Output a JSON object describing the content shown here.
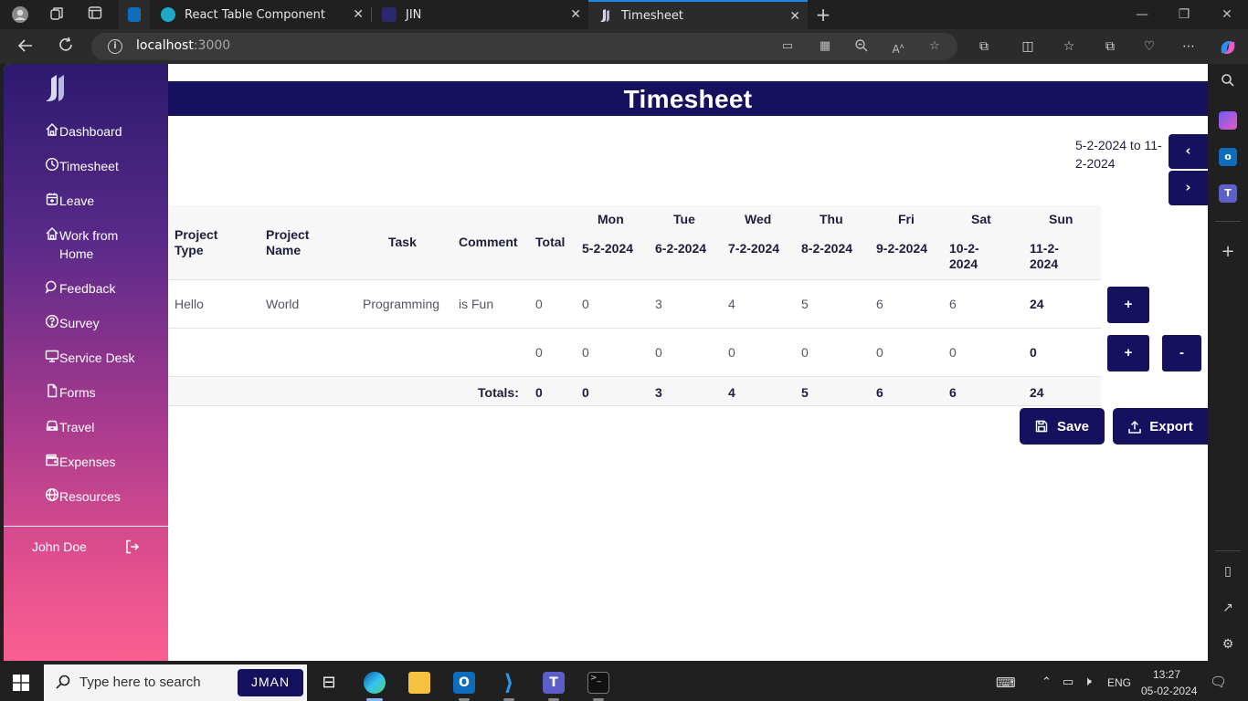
{
  "browser": {
    "tabs": [
      {
        "title": "React Table Component",
        "active": false
      },
      {
        "title": "JIN",
        "active": false
      },
      {
        "title": "Timesheet",
        "active": true
      }
    ],
    "url_host": "localhost",
    "url_port": ":3000"
  },
  "sidebar": {
    "items": [
      {
        "label": "Dashboard",
        "icon": "home-icon"
      },
      {
        "label": "Timesheet",
        "icon": "clock-icon"
      },
      {
        "label": "Leave",
        "icon": "calendar-icon"
      },
      {
        "label": "Work from Home",
        "icon": "home-icon"
      },
      {
        "label": "Feedback",
        "icon": "chat-icon"
      },
      {
        "label": "Survey",
        "icon": "question-circle-icon"
      },
      {
        "label": "Service Desk",
        "icon": "monitor-icon"
      },
      {
        "label": "Forms",
        "icon": "document-icon"
      },
      {
        "label": "Travel",
        "icon": "car-icon"
      },
      {
        "label": "Expenses",
        "icon": "wallet-icon"
      },
      {
        "label": "Resources",
        "icon": "globe-icon"
      }
    ],
    "user_name": "John Doe"
  },
  "page": {
    "title": "Timesheet",
    "date_range": "5-2-2024 to 11-2-2024",
    "prev_label": "‹",
    "next_label": "›"
  },
  "table": {
    "headers": {
      "project_type": "Project Type",
      "project_name": "Project Name",
      "task": "Task",
      "comment": "Comment",
      "total": "Total"
    },
    "days": [
      {
        "day": "Mon",
        "date": "5-2-2024"
      },
      {
        "day": "Tue",
        "date": "6-2-2024"
      },
      {
        "day": "Wed",
        "date": "7-2-2024"
      },
      {
        "day": "Thu",
        "date": "8-2-2024"
      },
      {
        "day": "Fri",
        "date": "9-2-2024"
      },
      {
        "day": "Sat",
        "date": "10-2-2024"
      },
      {
        "day": "Sun",
        "date": "11-2-2024"
      }
    ],
    "rows": [
      {
        "project_type": "Hello",
        "project_name": "World",
        "task": "Programming",
        "comment": "is Fun",
        "total": "0",
        "values": [
          "0",
          "3",
          "4",
          "5",
          "6",
          "6",
          "24"
        ]
      },
      {
        "project_type": "",
        "project_name": "",
        "task": "",
        "comment": "",
        "total": "0",
        "values": [
          "0",
          "0",
          "0",
          "0",
          "0",
          "0",
          "0"
        ]
      }
    ],
    "totals_label": "Totals:",
    "totals": {
      "total": "0",
      "values": [
        "0",
        "3",
        "4",
        "5",
        "6",
        "6",
        "24"
      ]
    },
    "add_label": "+",
    "remove_label": "-"
  },
  "actions": {
    "save_label": "Save",
    "export_label": "Export"
  },
  "taskbar": {
    "search_placeholder": "Type here to search",
    "jman_label": "JMAN",
    "language": "ENG",
    "time": "13:27",
    "date": "05-02-2024"
  },
  "colors": {
    "brand_navy": "#15115e",
    "sidebar_top": "#2c1a6e",
    "sidebar_bottom": "#fb5f91"
  }
}
